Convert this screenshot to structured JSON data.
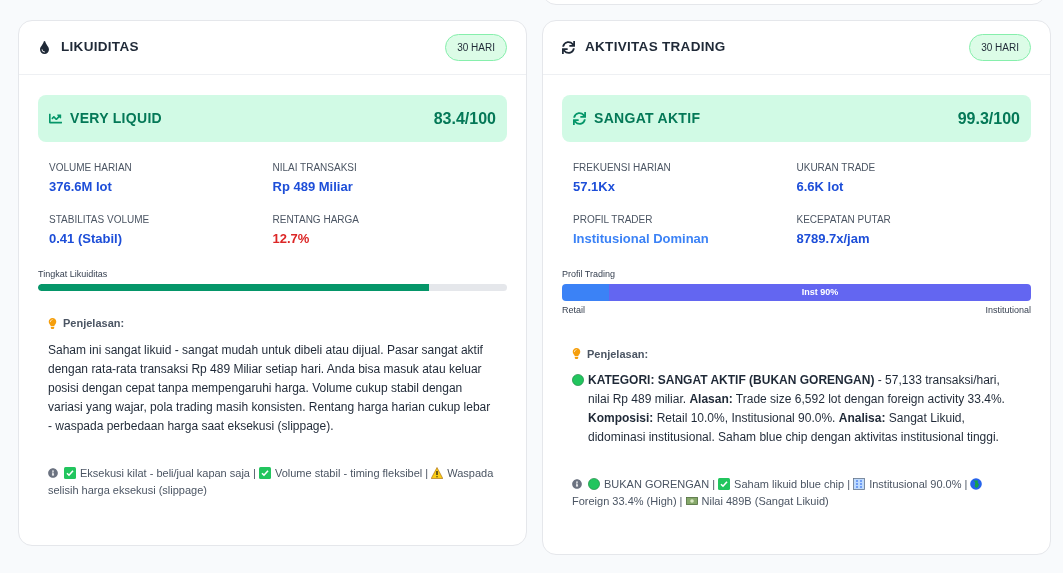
{
  "cards": [
    {
      "title": "LIKUIDITAS",
      "badge": "30 HARI",
      "status": {
        "label": "VERY LIQUID",
        "score": "83.4/100"
      },
      "metrics": [
        {
          "label": "VOLUME HARIAN",
          "value": "376.6M lot",
          "color": "#1d4ed8"
        },
        {
          "label": "NILAI TRANSAKSI",
          "value": "Rp 489 Miliar",
          "color": "#1d4ed8"
        },
        {
          "label": "STABILITAS VOLUME",
          "value": "0.41 (Stabil)",
          "color": "#1d4ed8"
        },
        {
          "label": "RENTANG HARGA",
          "value": "12.7%",
          "color": "#dc2626"
        }
      ],
      "bar": {
        "kind": "single",
        "title": "Tingkat Likuiditas",
        "level": 0.834
      },
      "explanation": {
        "title": "Penjelasan:",
        "text": "Saham ini sangat likuid - sangat mudah untuk dibeli atau dijual. Pasar sangat aktif dengan rata-rata transaksi Rp 489 Miliar setiap hari. Anda bisa masuk atau keluar posisi dengan cepat tanpa mempengaruhi harga. Volume cukup stabil dengan variasi yang wajar, pola trading masih konsisten. Rentang harga harian cukup lebar - waspada perbedaan harga saat eksekusi (slippage)."
      },
      "note": [
        "Eksekusi kilat - beli/jual kapan saja |",
        "Volume stabil - timing fleksibel |",
        "Waspada",
        "selisih harga eksekusi (slippage)"
      ]
    },
    {
      "title": "AKTIVITAS TRADING",
      "badge": "30 HARI",
      "status": {
        "label": "SANGAT AKTIF",
        "score": "99.3/100"
      },
      "metrics": [
        {
          "label": "FREKUENSI HARIAN",
          "value": "57.1Kx",
          "color": "#1d4ed8"
        },
        {
          "label": "UKURAN TRADE",
          "value": "6.6K lot",
          "color": "#1d4ed8"
        },
        {
          "label": "PROFIL TRADER",
          "value": "Institusional Dominan",
          "color": "#3b82f6"
        },
        {
          "label": "KECEPATAN PUTAR",
          "value": "8789.7x/jam",
          "color": "#1d4ed8"
        }
      ],
      "bar": {
        "kind": "split",
        "title": "Profil Trading",
        "label": "Inst 90%",
        "left_caption": "Retail",
        "right_caption": "Institutional"
      },
      "explanation": {
        "title": "Penjelasan:",
        "text": "**KATEGORI: SANGAT AKTIF (BUKAN GORENGAN)** - 57,133 transaksi/hari, nilai Rp 489 miliar. **Alasan:** Trade size 6,592 lot dengan foreign activity 33.4%. **Komposisi:** Retail 10.0%, Institusional 90.0%. **Analisa:** Sangat Likuid, didominasi institusional. Saham blue chip dengan aktivitas institusional tinggi."
      },
      "note": [
        "BUKAN GORENGAN |",
        "Saham likuid blue chip |",
        "Institusional 90.0% |",
        "Foreign",
        "33.4% (High) |",
        "Nilai 489B (Sangat Likuid)"
      ]
    }
  ]
}
